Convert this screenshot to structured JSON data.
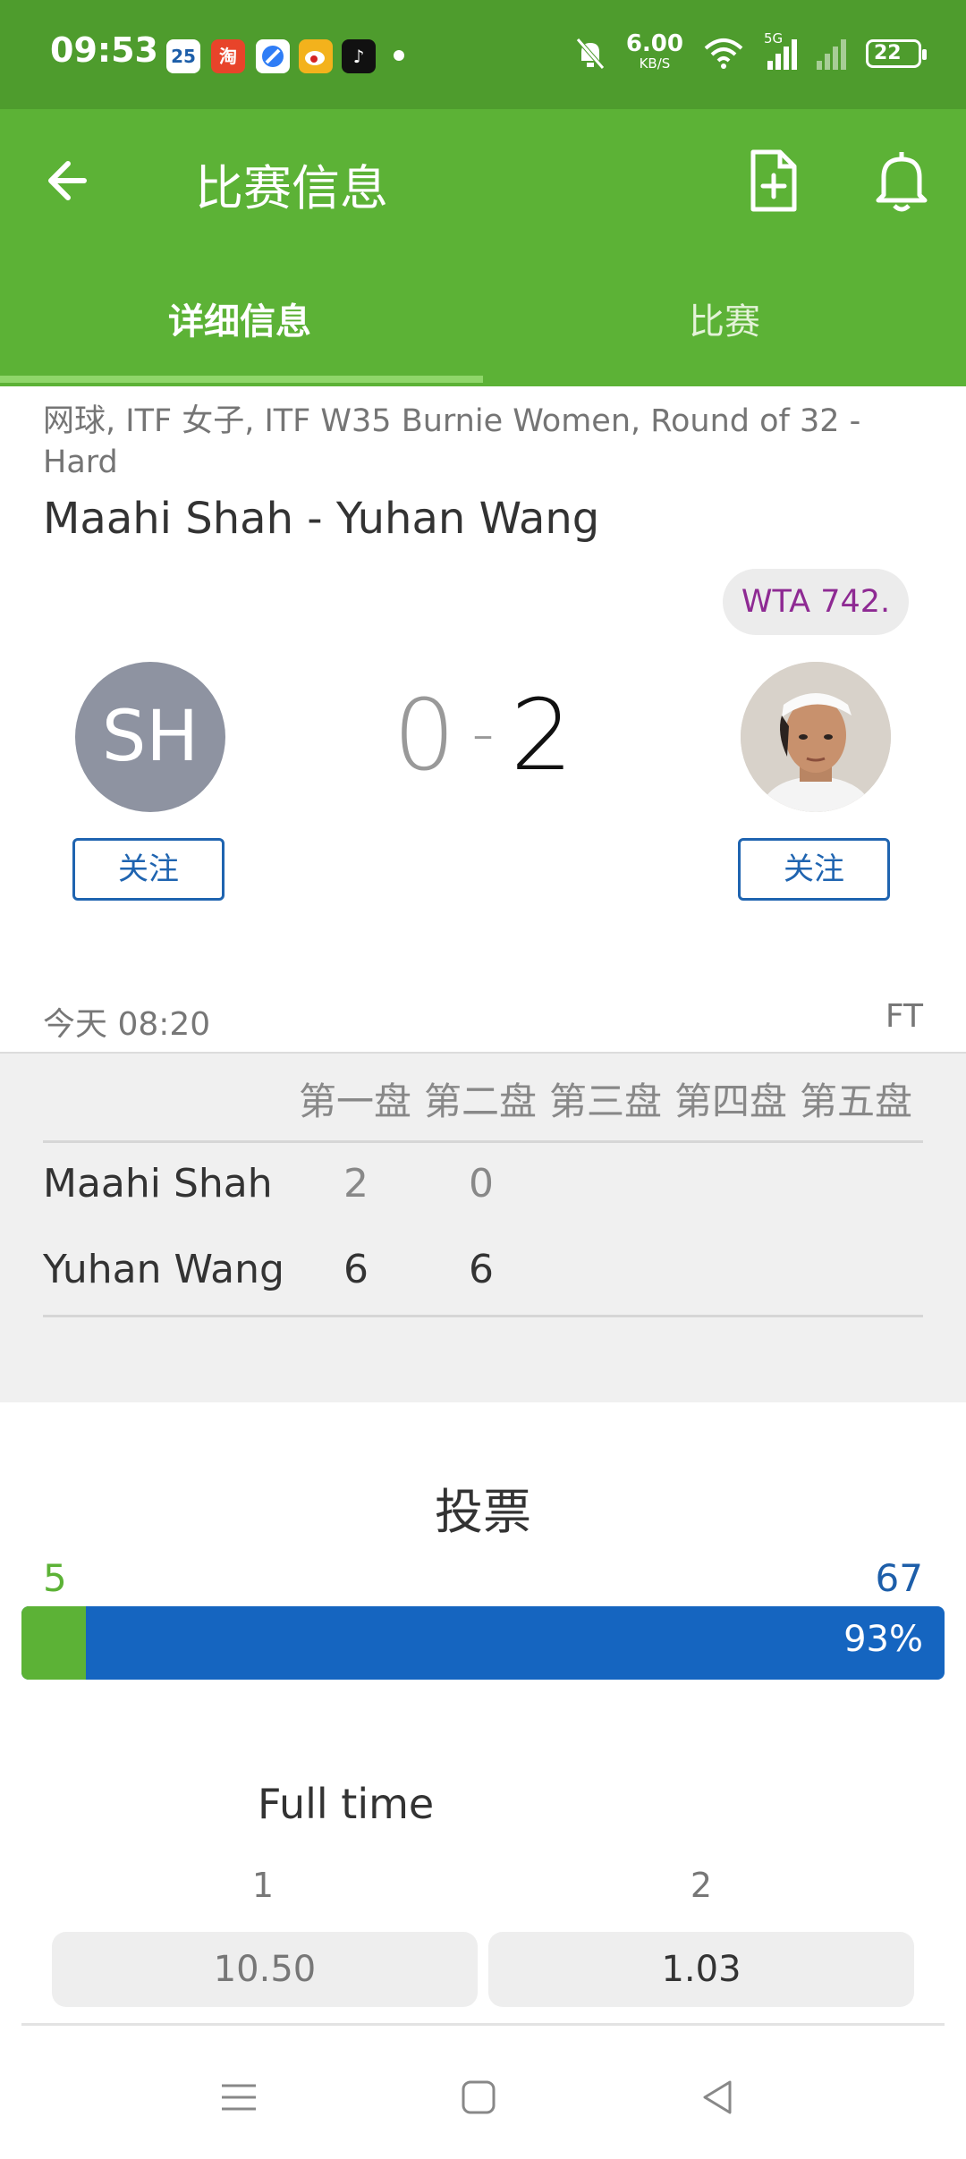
{
  "status_bar": {
    "time": "09:53",
    "app_icons": [
      "calendar-icon",
      "taobao-icon",
      "browser-icon",
      "weibo-icon",
      "tiktok-icon"
    ],
    "calendar_day": "25",
    "speed_value": "6.00",
    "speed_unit": "KB/S",
    "network": "5G",
    "battery": "22"
  },
  "app_bar": {
    "title": "比赛信息",
    "back_icon": "arrow-left-icon",
    "file_icon": "file-plus-icon",
    "bell_icon": "bell-icon"
  },
  "tabs": [
    {
      "label": "详细信息",
      "active": true
    },
    {
      "label": "比赛",
      "active": false
    }
  ],
  "match": {
    "meta": "网球, ITF 女子, ITF W35 Burnie Women, Round of 32 - Hard",
    "title": "Maahi Shah - Yuhan Wang",
    "ranking_badge": "WTA 742.",
    "player1_initials": "SH",
    "score_home": "0",
    "score_separator": "-",
    "score_away": "2",
    "follow_label": "关注",
    "start_time": "今天 08:20",
    "status": "FT"
  },
  "set_scores": {
    "headers": [
      "第一盘",
      "第二盘",
      "第三盘",
      "第四盘",
      "第五盘"
    ],
    "rows": [
      {
        "name": "Maahi Shah",
        "sets": [
          "2",
          "0"
        ]
      },
      {
        "name": "Yuhan Wang",
        "sets": [
          "6",
          "6"
        ]
      }
    ]
  },
  "vote": {
    "title": "投票",
    "left_count": "5",
    "right_count": "67",
    "right_percent_label": "93%",
    "left_fraction": 0.07,
    "left_color": "#5cb236",
    "right_color": "#1565c0"
  },
  "odds": {
    "title": "Full time",
    "labels": [
      "1",
      "2"
    ],
    "values": [
      "10.50",
      "1.03"
    ]
  },
  "navigation": {
    "menu_icon": "menu-icon",
    "home_icon": "home-square-icon",
    "back_icon": "back-triangle-icon"
  },
  "colors": {
    "status_bar": "#4e9c2d",
    "app_bar": "#5cb236",
    "accent_blue": "#1f64b0",
    "rank_purple": "#8e2a93"
  }
}
